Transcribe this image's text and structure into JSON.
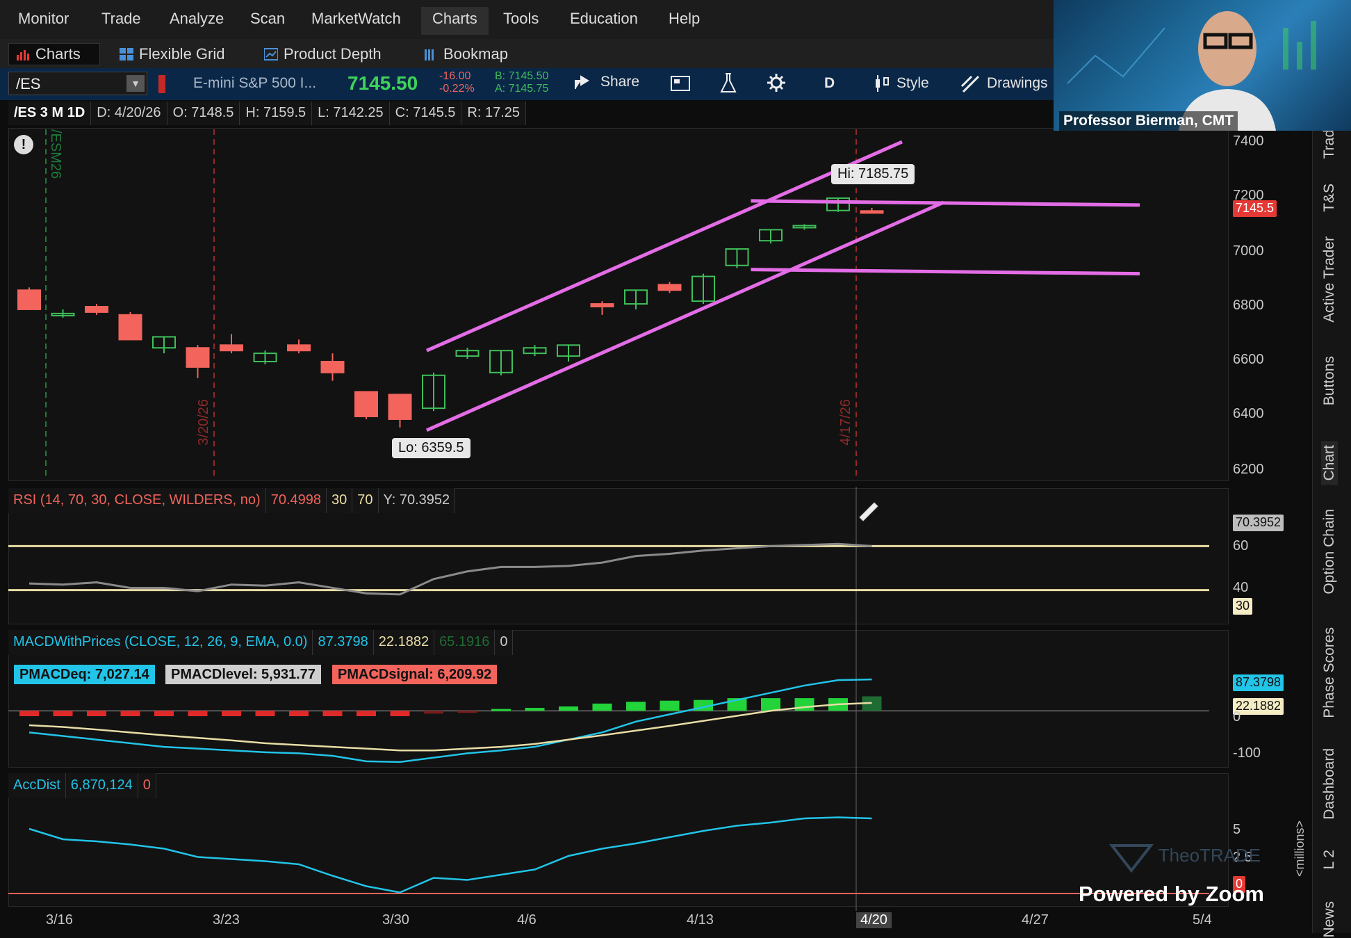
{
  "menu": [
    "Monitor",
    "Trade",
    "Analyze",
    "Scan",
    "MarketWatch",
    "Charts",
    "Tools",
    "Education",
    "Help"
  ],
  "subtabs": [
    "Charts",
    "Flexible Grid",
    "Product Depth",
    "Bookmap"
  ],
  "toolbar": {
    "symbol": "/ES",
    "description": "E-mini S&P 500 I...",
    "last": "7145.50",
    "change": "-16.00",
    "change_pct": "-0.22%",
    "bid": "B: 7145.50",
    "ask": "A: 7145.75",
    "share": "Share",
    "period": "D",
    "style": "Style",
    "drawings": "Drawings"
  },
  "info": {
    "symbol_period": "/ES 3 M 1D",
    "date": "D: 4/20/26",
    "open": "O: 7148.5",
    "high": "H: 7159.5",
    "low": "L: 7142.25",
    "close": "C: 7145.5",
    "range": "R: 17.25"
  },
  "price_axis": [
    "7400",
    "7200",
    "7000",
    "6800",
    "6600",
    "6400",
    "6200"
  ],
  "price_tag": "7145.5",
  "callouts": {
    "hi": "Hi: 7185.75",
    "lo": "Lo: 6359.5"
  },
  "vertical_markers": [
    "/ESM26",
    "3/20/26",
    "4/17/26"
  ],
  "rsi": {
    "label": "RSI (14, 70, 30, CLOSE, WILDERS, no)",
    "value": "70.4998",
    "os": "30",
    "ob": "70",
    "y": "Y: 70.3952",
    "axis": [
      "60",
      "40"
    ],
    "tag_value": "70.3952",
    "tag_30": "30"
  },
  "macd": {
    "label": "MACDWithPrices (CLOSE, 12, 26, 9, EMA, 0.0)",
    "value": "87.3798",
    "avg": "22.1882",
    "diff": "65.1916",
    "zero": "0",
    "peq": "PMACDeq: 7,027.14",
    "plevel": "PMACDlevel: 5,931.77",
    "psignal": "PMACDsignal: 6,209.92",
    "tag_value": "87.3798",
    "tag_avg": "22.1882",
    "axis_zero": "0",
    "axis_neg": "-100"
  },
  "accdist": {
    "label": "AccDist",
    "value": "6,870,124",
    "zero": "0",
    "axis": [
      "5",
      "2.5"
    ],
    "tag_zero": "0",
    "units": "<millions>"
  },
  "dates": [
    "3/16",
    "3/23",
    "3/30",
    "4/6",
    "4/13",
    "4/20",
    "4/27",
    "5/4"
  ],
  "side_rail": [
    "Trad",
    "T&S",
    "Active Trader",
    "Buttons",
    "Chart",
    "Option Chain",
    "Phase Scores",
    "Dashboard",
    "L 2",
    "News"
  ],
  "webcam_name": "Professor Bierman, CMT",
  "zoom_label": "Powered by Zoom",
  "watermark": "TheoTRADE",
  "colors": {
    "up": "#3fbf5a",
    "down": "#f2645c",
    "channel": "#e36de6",
    "cyan": "#22c4e8",
    "cream": "#e9dda6"
  },
  "chart_data": {
    "type": "candlestick",
    "symbol": "/ES",
    "ylim": [
      6200,
      7400
    ],
    "candles": [
      {
        "o": 6860,
        "h": 6870,
        "l": 6790,
        "c": 6790
      },
      {
        "o": 6770,
        "h": 6790,
        "l": 6760,
        "c": 6775
      },
      {
        "o": 6800,
        "h": 6810,
        "l": 6770,
        "c": 6780
      },
      {
        "o": 6770,
        "h": 6780,
        "l": 6680,
        "c": 6680
      },
      {
        "o": 6650,
        "h": 6690,
        "l": 6630,
        "c": 6690
      },
      {
        "o": 6650,
        "h": 6660,
        "l": 6540,
        "c": 6580
      },
      {
        "o": 6660,
        "h": 6700,
        "l": 6630,
        "c": 6640
      },
      {
        "o": 6600,
        "h": 6640,
        "l": 6590,
        "c": 6630
      },
      {
        "o": 6660,
        "h": 6680,
        "l": 6630,
        "c": 6640
      },
      {
        "o": 6600,
        "h": 6630,
        "l": 6530,
        "c": 6560
      },
      {
        "o": 6490,
        "h": 6490,
        "l": 6390,
        "c": 6400
      },
      {
        "o": 6480,
        "h": 6480,
        "l": 6360,
        "c": 6390
      },
      {
        "o": 6430,
        "h": 6560,
        "l": 6420,
        "c": 6550
      },
      {
        "o": 6620,
        "h": 6650,
        "l": 6610,
        "c": 6640
      },
      {
        "o": 6560,
        "h": 6640,
        "l": 6550,
        "c": 6640
      },
      {
        "o": 6630,
        "h": 6660,
        "l": 6620,
        "c": 6650
      },
      {
        "o": 6620,
        "h": 6610,
        "l": 6600,
        "c": 6660
      },
      {
        "o": 6810,
        "h": 6820,
        "l": 6770,
        "c": 6800
      },
      {
        "o": 6810,
        "h": 6860,
        "l": 6790,
        "c": 6860
      },
      {
        "o": 6880,
        "h": 6890,
        "l": 6850,
        "c": 6860
      },
      {
        "o": 6820,
        "h": 6920,
        "l": 6810,
        "c": 6910
      },
      {
        "o": 6950,
        "h": 7010,
        "l": 6940,
        "c": 7010
      },
      {
        "o": 7040,
        "h": 7080,
        "l": 7030,
        "c": 7080
      },
      {
        "o": 7090,
        "h": 7100,
        "l": 7080,
        "c": 7095
      },
      {
        "o": 7150,
        "h": 7185.75,
        "l": 7145,
        "c": 7195
      },
      {
        "o": 7148.5,
        "h": 7159.5,
        "l": 7142.25,
        "c": 7145.5
      }
    ],
    "rsi_ylim": [
      0,
      100
    ],
    "rsi": [
      36,
      35,
      37,
      32,
      32,
      29,
      35,
      34,
      37,
      32,
      27,
      26,
      40,
      47,
      51,
      51,
      52,
      55,
      61,
      63,
      66,
      68,
      70,
      71,
      72,
      70
    ],
    "macd_ylim": [
      -150,
      120
    ],
    "macd_value": [
      -60,
      -70,
      -80,
      -90,
      -100,
      -105,
      -110,
      -115,
      -118,
      -125,
      -140,
      -142,
      -130,
      -118,
      -110,
      -100,
      -80,
      -60,
      -30,
      -10,
      10,
      30,
      50,
      70,
      85,
      87
    ],
    "macd_avg": [
      -40,
      -45,
      -52,
      -60,
      -68,
      -75,
      -82,
      -90,
      -95,
      -100,
      -105,
      -110,
      -110,
      -105,
      -100,
      -92,
      -80,
      -68,
      -55,
      -42,
      -28,
      -14,
      0,
      10,
      18,
      22
    ],
    "macd_hist": [
      -15,
      -15,
      -15,
      -15,
      -15,
      -15,
      -15,
      -15,
      -15,
      -15,
      -15,
      -15,
      -8,
      -4,
      5,
      8,
      12,
      20,
      25,
      28,
      30,
      35,
      35,
      35,
      35,
      40
    ],
    "acc_ylim": [
      -1,
      9
    ],
    "accdist": [
      6.2,
      5.2,
      5.0,
      4.7,
      4.3,
      3.5,
      3.3,
      3.1,
      2.8,
      1.7,
      0.7,
      0.1,
      1.5,
      1.3,
      1.8,
      2.3,
      3.6,
      4.3,
      4.8,
      5.4,
      6.0,
      6.5,
      6.8,
      7.2,
      7.3,
      7.2
    ]
  }
}
